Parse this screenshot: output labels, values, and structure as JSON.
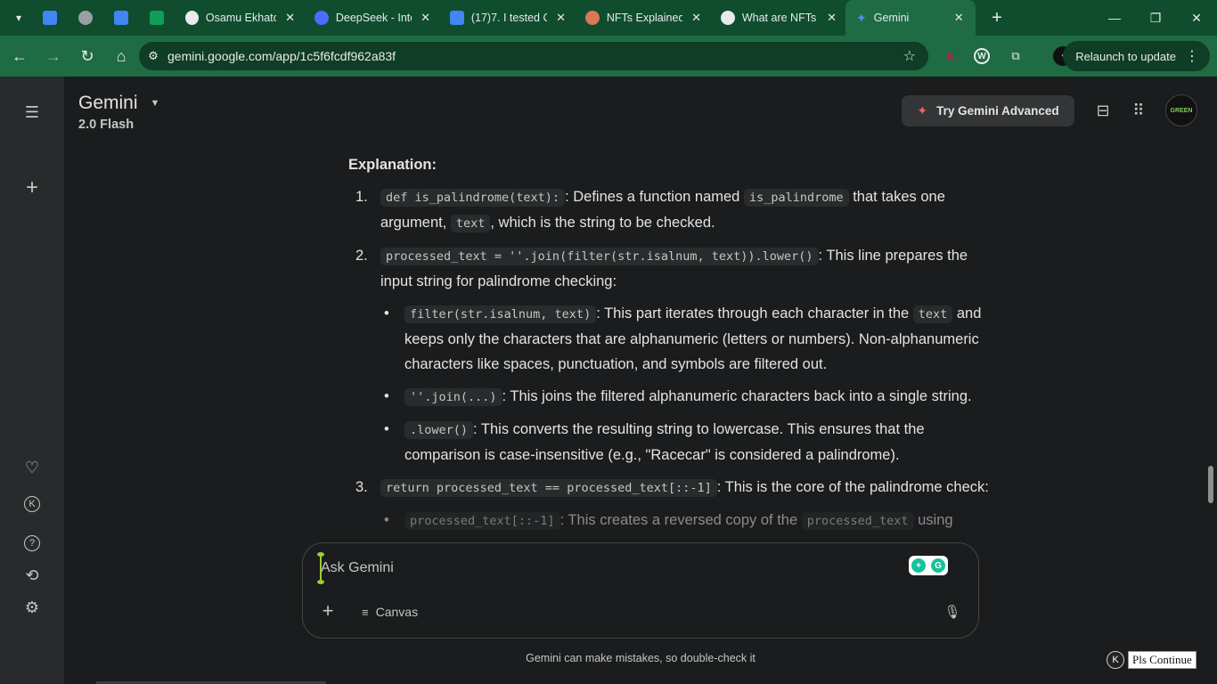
{
  "browser": {
    "tabs": [
      {
        "label": "",
        "icon": "google-docs-icon",
        "color": "#4285f4",
        "pinned": true
      },
      {
        "label": "",
        "icon": "globe-icon",
        "color": "#9aa0a6",
        "pinned": true
      },
      {
        "label": "",
        "icon": "google-docs-icon",
        "color": "#4285f4",
        "pinned": true
      },
      {
        "label": "",
        "icon": "google-sheets-icon",
        "color": "#0f9d58",
        "pinned": true
      },
      {
        "label": "Osamu Ekhator",
        "icon": "openai-icon",
        "color": "#e8eaed"
      },
      {
        "label": "DeepSeek - Into",
        "icon": "deepseek-icon",
        "color": "#4d6bfe"
      },
      {
        "label": "(17)7. I tested C",
        "icon": "google-docs-icon",
        "color": "#4285f4"
      },
      {
        "label": "NFTs Explained",
        "icon": "claude-icon",
        "color": "#d97757"
      },
      {
        "label": "What are NFTs",
        "icon": "openai-icon",
        "color": "#e8eaed"
      },
      {
        "label": "Gemini",
        "icon": "gemini-icon",
        "color": "#4f8ef7",
        "active": true
      }
    ],
    "url": "gemini.google.com/app/1c5f6fcdf962a83f",
    "relaunch_label": "Relaunch to update"
  },
  "header": {
    "title": "Gemini",
    "model": "2.0 Flash",
    "try_advanced": "Try Gemini Advanced",
    "avatar_text": "GREEN"
  },
  "content": {
    "heading": "Explanation:",
    "item1": {
      "num": "1.",
      "code1": "def is_palindrome(text):",
      "t1": ": Defines a function named ",
      "code2": "is_palindrome",
      "t2": " that takes one argument, ",
      "code3": "text",
      "t3": ", which is the string to be checked."
    },
    "item2": {
      "num": "2.",
      "code1": "processed_text = ''.join(filter(str.isalnum, text)).lower()",
      "t1": ": This line prepares the input string for palindrome checking:",
      "b1_code": "filter(str.isalnum, text)",
      "b1_t1": ": This part iterates through each character in the ",
      "b1_code2": "text",
      "b1_t2": " and keeps only the characters that are alphanumeric (letters or numbers). Non-alphanumeric characters like spaces, punctuation, and symbols are filtered out.",
      "b2_code": "''.join(...)",
      "b2_t1": ": This joins the filtered alphanumeric characters back into a single string.",
      "b3_code": ".lower()",
      "b3_t1": ": This converts the resulting string to lowercase. This ensures that the comparison is case-insensitive (e.g., \"Racecar\" is considered a palindrome)."
    },
    "item3": {
      "num": "3.",
      "code1": "return processed_text == processed_text[::-1]",
      "t1": ": This is the core of the palindrome check:",
      "b1_code": "processed_text[::-1]",
      "b1_t1": ": This creates a reversed copy of the ",
      "b1_code2": "processed_text",
      "b1_t2": " using"
    }
  },
  "composer": {
    "placeholder": "Ask Gemini",
    "canvas_label": "Canvas"
  },
  "footer": {
    "disclaimer": "Gemini can make mistakes, so double-check it",
    "continue_label": "Pls Continue",
    "k_label": "K"
  },
  "colors": {
    "tabstrip": "#0f4d2e",
    "toolbar": "#1e6b44",
    "sidebar": "#282a2c",
    "main_bg": "#1b1c1d",
    "accent_spark": "#e46962"
  }
}
